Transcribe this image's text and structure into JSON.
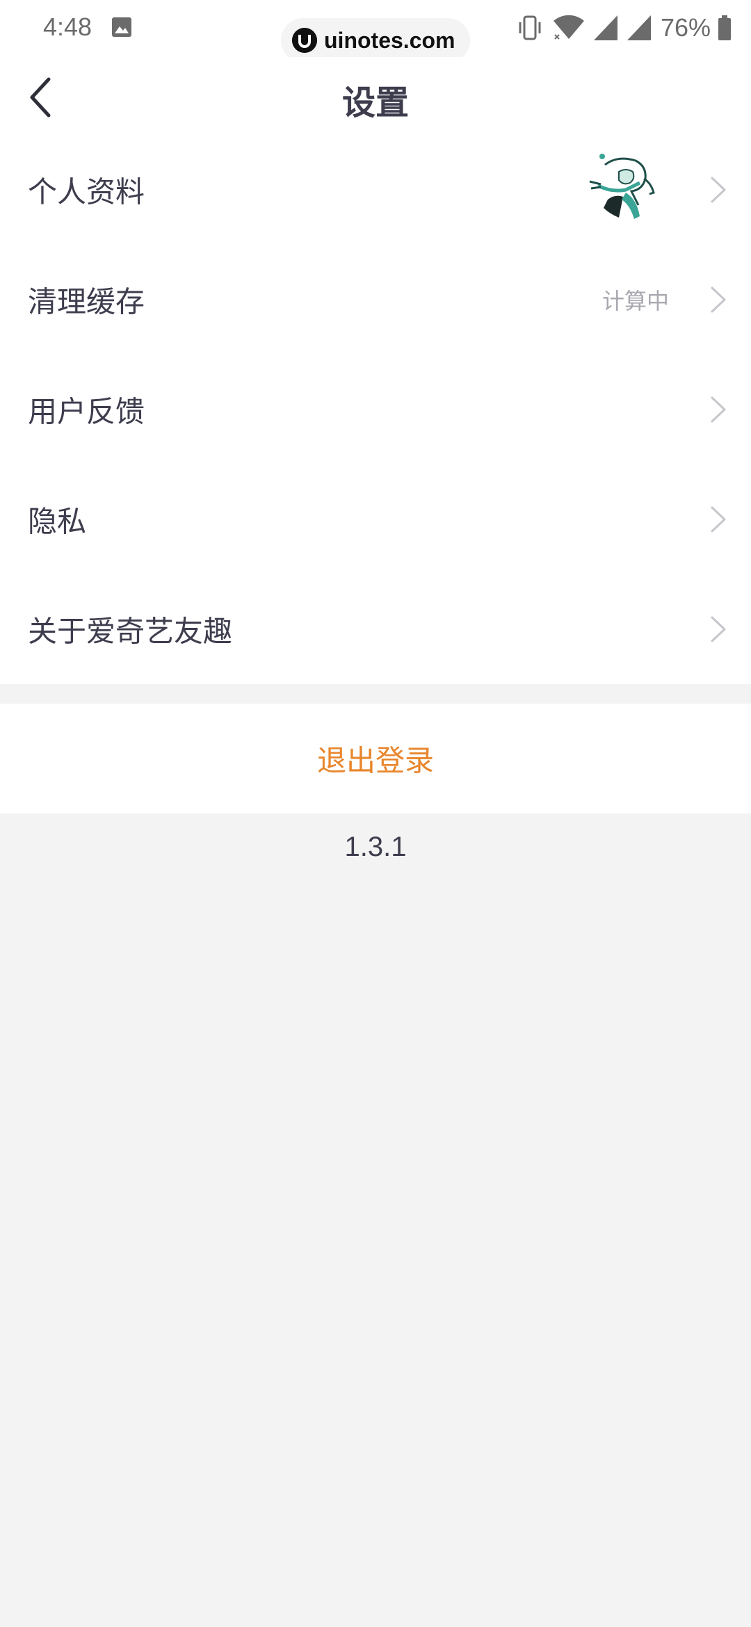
{
  "status_bar": {
    "time": "4:48",
    "battery_percent": "76%",
    "icons": [
      "image-icon",
      "vibrate-icon",
      "wifi-icon",
      "signal-icon",
      "signal-icon",
      "battery-icon"
    ]
  },
  "watermark": {
    "text": "uinotes.com"
  },
  "header": {
    "title": "设置",
    "back_icon": "chevron-left-icon"
  },
  "settings": {
    "items": [
      {
        "label": "个人资料",
        "trailing": "avatar"
      },
      {
        "label": "清理缓存",
        "value": "计算中"
      },
      {
        "label": "用户反馈"
      },
      {
        "label": "隐私"
      },
      {
        "label": "关于爱奇艺友趣"
      }
    ],
    "chevron_icon": "chevron-right-icon"
  },
  "logout": {
    "label": "退出登录"
  },
  "version": "1.3.1",
  "colors": {
    "accent": "#e8862c",
    "text_primary": "#3d3d4e",
    "text_secondary": "#a8a8b0",
    "background": "#f3f3f3",
    "surface": "#ffffff",
    "avatar_teal": "#3aa596"
  }
}
